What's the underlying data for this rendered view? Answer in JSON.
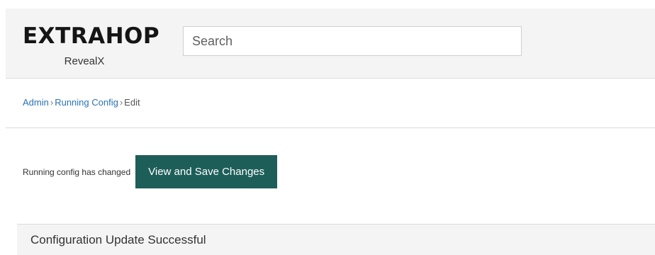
{
  "header": {
    "logo_text": "EXTRAHOP",
    "logo_subtitle": "RevealX",
    "search": {
      "placeholder": "Search",
      "value": ""
    }
  },
  "breadcrumb": {
    "items": [
      "Admin",
      "Running Config",
      "Edit"
    ],
    "separator": "›"
  },
  "status": {
    "message": "Running config has changed",
    "button_label": "View and Save Changes"
  },
  "banner": {
    "message": "Configuration Update Successful"
  },
  "colors": {
    "primary_button": "#1d5e59",
    "link": "#2a73b5",
    "header_bg": "#f4f4f4"
  }
}
